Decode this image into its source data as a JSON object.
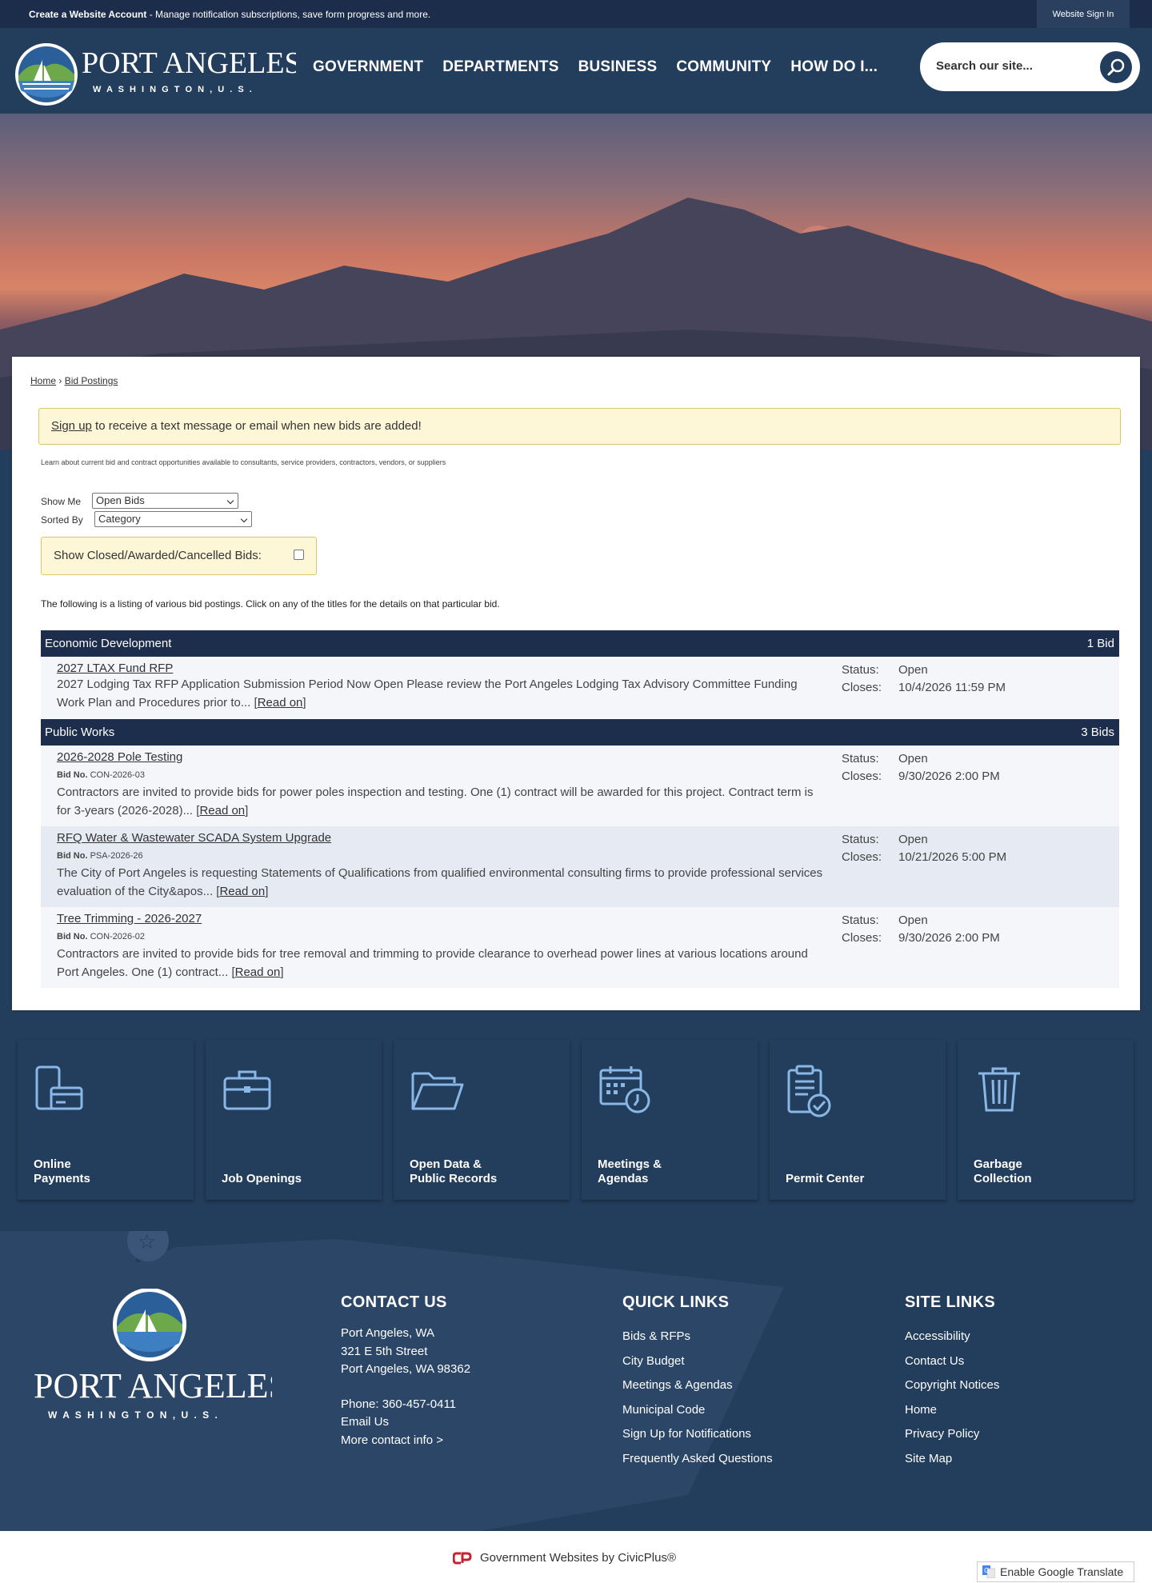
{
  "topbar": {
    "create_account": "Create a Website Account",
    "create_account_desc": " - Manage notification subscriptions, save form progress and more.",
    "sign_in": "Website Sign In"
  },
  "logo": {
    "name": "PORT ANGELES",
    "sub": "W A S H I N G T O N ,  U . S ."
  },
  "nav": [
    "GOVERNMENT",
    "DEPARTMENTS",
    "BUSINESS",
    "COMMUNITY",
    "HOW DO I..."
  ],
  "search": {
    "placeholder": "Search our site..."
  },
  "breadcrumb": {
    "home": "Home",
    "sep": "›",
    "current": "Bid Postings"
  },
  "notice": {
    "link": "Sign up",
    "text": " to receive a text message or email when new bids are added!"
  },
  "intro": "Learn about current bid and contract opportunities available to consultants, service providers, contractors, vendors, or suppliers",
  "filters": {
    "show_me_label": "Show Me",
    "show_me_value": "Open Bids",
    "sorted_by_label": "Sorted By",
    "sorted_by_value": "Category",
    "closed_label": "Show Closed/Awarded/Cancelled Bids:"
  },
  "listing_text": "The following is a listing of various bid postings. Click on any of the titles for the details on that particular bid.",
  "status_label": "Status:",
  "closes_label": "Closes:",
  "bidno_label": "Bid No.",
  "read_on": "Read on",
  "categories": [
    {
      "name": "Economic Development",
      "count": "1 Bid"
    },
    {
      "name": "Public Works",
      "count": "3 Bids"
    }
  ],
  "bids": [
    {
      "title": "2027 LTAX Fund RFP",
      "bid_no": "",
      "desc": "2027 Lodging Tax RFP Application Submission Period Now Open Please review the Port Angeles Lodging Tax Advisory Committee Funding Work Plan and Procedures prior to...",
      "status": "Open",
      "closes": "10/4/2026 11:59 PM"
    },
    {
      "title": "2026-2028 Pole Testing",
      "bid_no": "CON-2026-03",
      "desc": "Contractors are invited to provide bids for power poles inspection and testing. One (1) contract will be awarded for this project. Contract term is for 3-years (2026-2028)...",
      "status": "Open",
      "closes": "9/30/2026 2:00 PM"
    },
    {
      "title": "RFQ Water & Wastewater SCADA System Upgrade",
      "bid_no": "PSA-2026-26",
      "desc": "The City of Port Angeles is requesting Statements of Qualifications from qualified environmental consulting firms to provide professional services evaluation of the City&apos...",
      "status": "Open",
      "closes": "10/21/2026 5:00 PM"
    },
    {
      "title": "Tree Trimming - 2026-2027",
      "bid_no": "CON-2026-02",
      "desc": "Contractors are invited to provide bids for tree removal and trimming to provide clearance to overhead power lines at various locations around Port Angeles. One (1) contract...",
      "status": "Open",
      "closes": "9/30/2026 2:00 PM"
    }
  ],
  "tiles": [
    {
      "line1": "Online",
      "line2": "Payments",
      "icon": "payment-icon"
    },
    {
      "line1": "Job Openings",
      "line2": "",
      "icon": "briefcase-icon"
    },
    {
      "line1": "Open Data &",
      "line2": "Public Records",
      "icon": "folder-icon"
    },
    {
      "line1": "Meetings &",
      "line2": "Agendas",
      "icon": "calendar-icon"
    },
    {
      "line1": "Permit Center",
      "line2": "",
      "icon": "clipboard-check-icon"
    },
    {
      "line1": "Garbage",
      "line2": "Collection",
      "icon": "trash-icon"
    }
  ],
  "footer": {
    "contact": {
      "heading": "CONTACT US",
      "lines": [
        "Port Angeles, WA",
        "321 E 5th Street",
        "Port Angeles, WA 98362"
      ],
      "phone": "Phone: 360-457-0411",
      "email": "Email Us",
      "more": "More contact info >"
    },
    "quick_links": {
      "heading": "QUICK LINKS",
      "items": [
        "Bids & RFPs",
        "City Budget",
        "Meetings & Agendas",
        "Municipal Code",
        "Sign Up for Notifications",
        "Frequently Asked Questions"
      ]
    },
    "site_links": {
      "heading": "SITE LINKS",
      "items": [
        "Accessibility",
        "Contact Us",
        "Copyright Notices",
        "Home",
        "Privacy Policy",
        "Site Map"
      ]
    }
  },
  "bottom": {
    "civicplus": "Government Websites by CivicPlus®",
    "translate": "Enable Google Translate"
  },
  "colors": {
    "navy": "#233d5c",
    "dark_navy": "#1d2d4c",
    "notice_bg": "#fdf7d8"
  }
}
